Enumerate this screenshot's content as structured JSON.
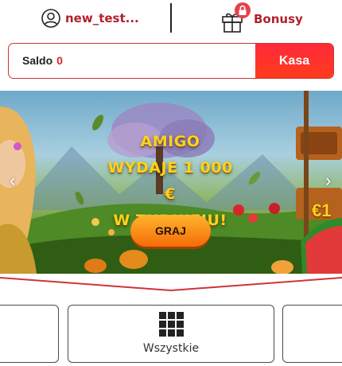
{
  "header": {
    "username": "new_test...",
    "bonus_label": "Bonusy",
    "bonus_badge_icon": "lock-icon",
    "accent_color": "#b3202c"
  },
  "balance": {
    "label": "Saldo",
    "value": "0",
    "cashier_label": "Kasa"
  },
  "banner": {
    "promo_lines": [
      "AMIGO",
      "WYDAJE 1 000 €",
      "W TURNIEJU!"
    ],
    "cta_label": "GRAJ",
    "sign_text": "€1",
    "prev_icon": "chevron-left-icon",
    "next_icon": "chevron-right-icon"
  },
  "categories": {
    "items": [
      {
        "label": "",
        "icon": ""
      },
      {
        "label": "Wszystkie",
        "icon": "grid-icon"
      },
      {
        "label": "",
        "icon": ""
      }
    ]
  }
}
